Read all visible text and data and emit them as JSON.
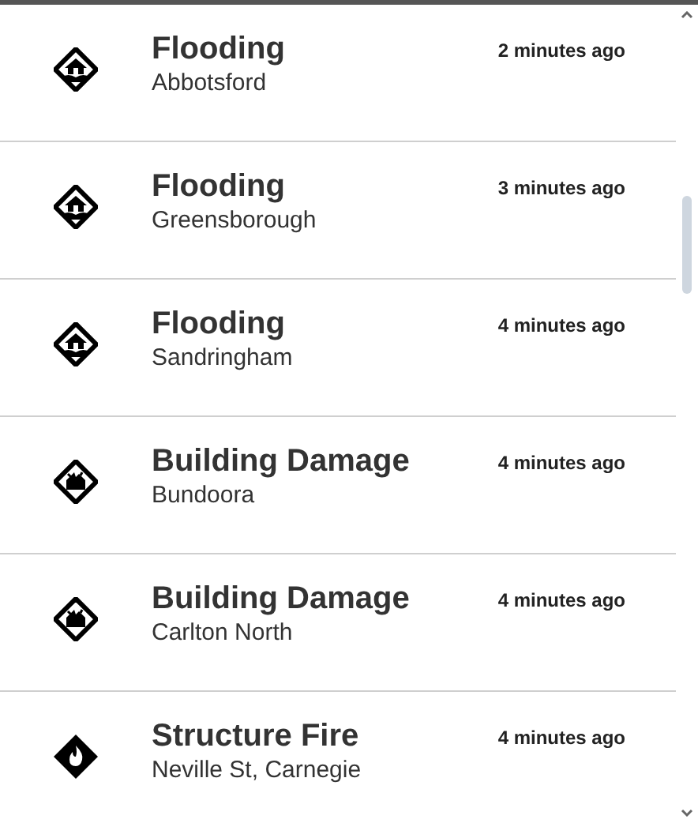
{
  "incidents": [
    {
      "kind": "flood",
      "title": "Flooding",
      "location": "Abbotsford",
      "time": "2 minutes ago"
    },
    {
      "kind": "flood",
      "title": "Flooding",
      "location": "Greensborough",
      "time": "3 minutes ago"
    },
    {
      "kind": "flood",
      "title": "Flooding",
      "location": "Sandringham",
      "time": "4 minutes ago"
    },
    {
      "kind": "damage",
      "title": "Building Damage",
      "location": "Bundoora",
      "time": "4 minutes ago"
    },
    {
      "kind": "damage",
      "title": "Building Damage",
      "location": "Carlton North",
      "time": "4 minutes ago"
    },
    {
      "kind": "fire",
      "title": "Structure Fire",
      "location": "Neville St, Carnegie",
      "time": "4 minutes ago"
    }
  ]
}
